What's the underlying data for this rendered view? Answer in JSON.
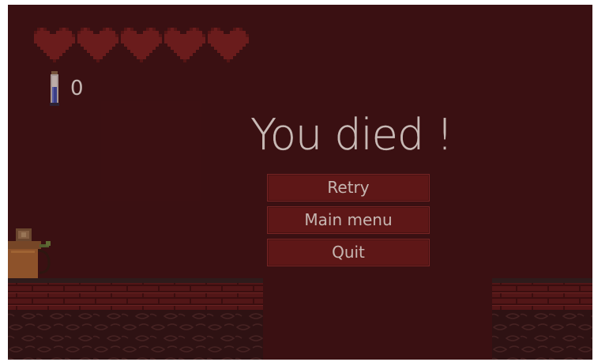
{
  "hud": {
    "hearts_total": 5,
    "hearts_filled": 0,
    "heart_icon": "heart-empty-icon",
    "potion_icon": "potion-bottle-icon",
    "potion_count": "0"
  },
  "overlay": {
    "title": "You died !",
    "buttons": {
      "retry": "Retry",
      "main_menu": "Main menu",
      "quit": "Quit"
    }
  },
  "colors": {
    "background": "#3a1214",
    "button_fill": "#6a1b1b",
    "button_border": "#8a2d2d",
    "text": "#f4efe8",
    "heart": "#7a2222",
    "brick": "#5a1a1b",
    "soil": "#2a1516"
  }
}
